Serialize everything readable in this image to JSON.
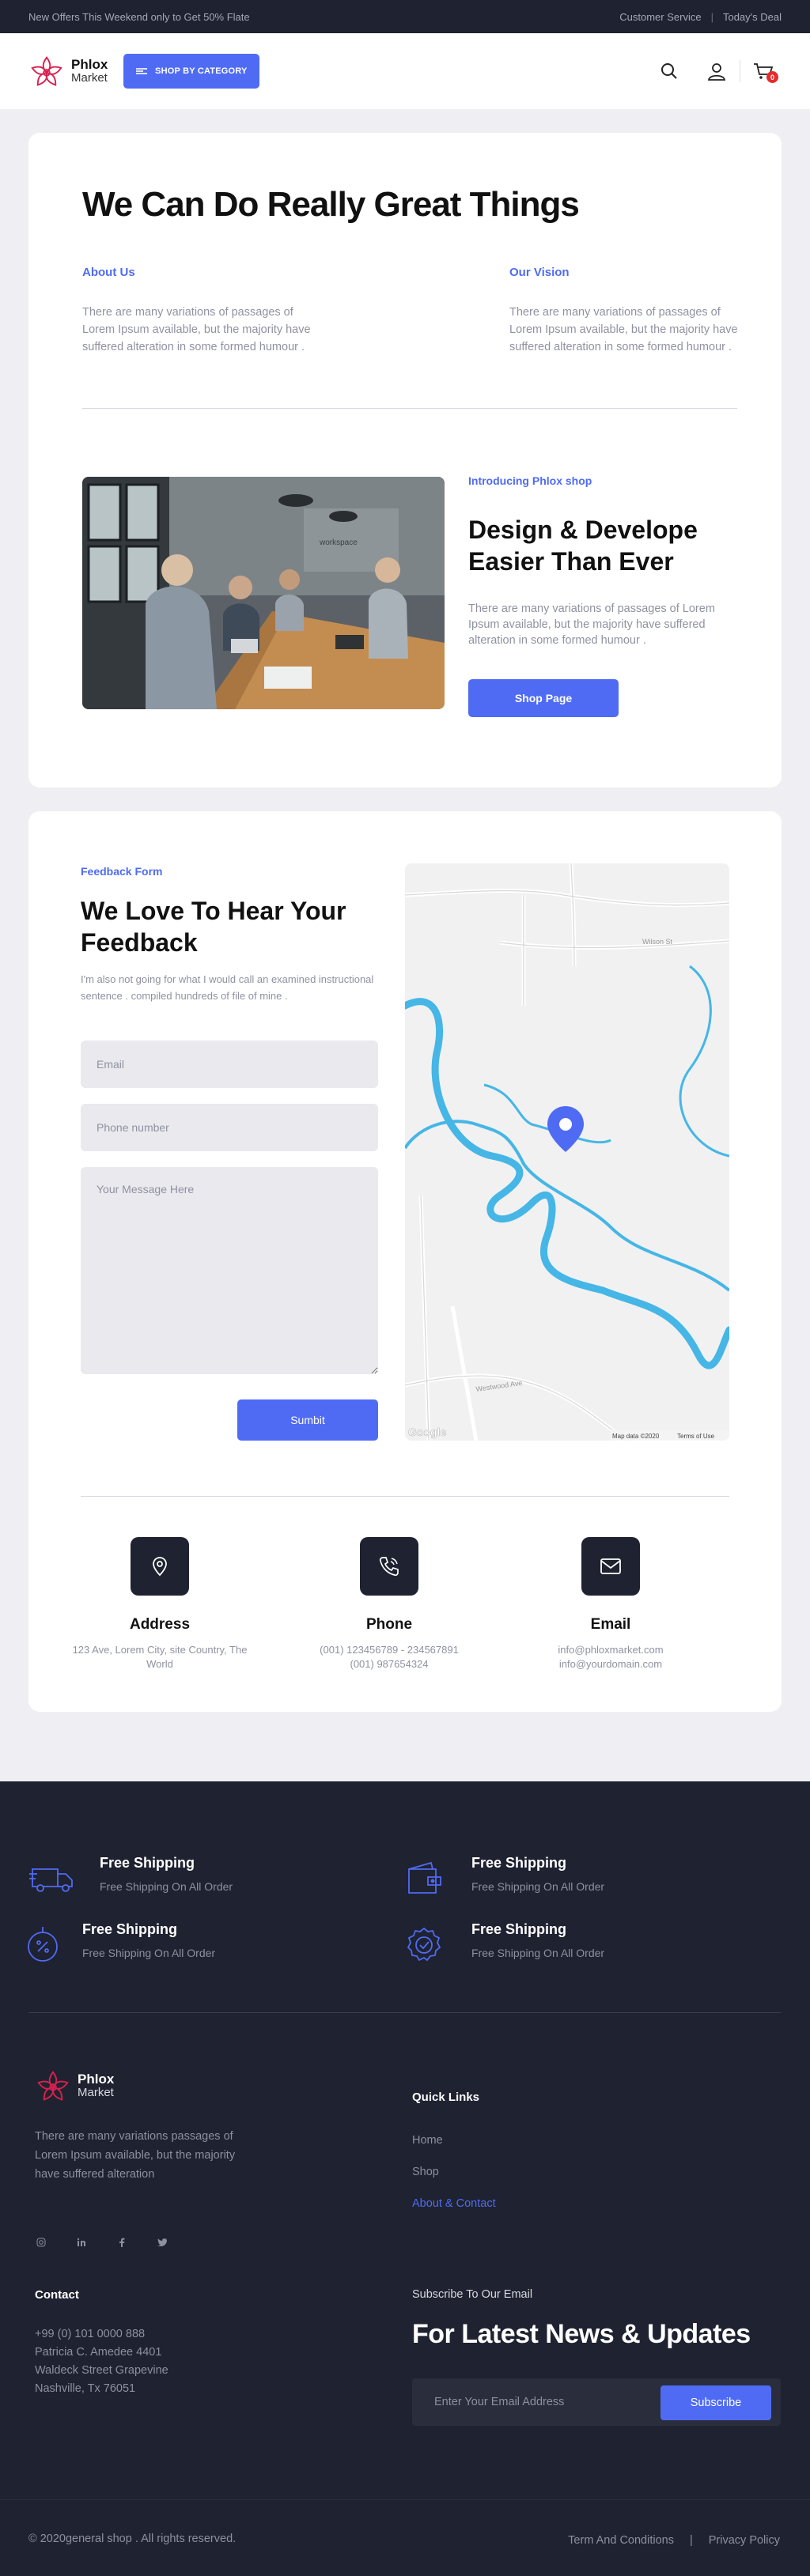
{
  "topbar": {
    "promo": "New Offers This Weekend only to Get 50% Flate",
    "customer_service": "Customer Service",
    "separator": "|",
    "todays_deal": "Today's Deal"
  },
  "brand": {
    "name": "Phlox",
    "sub": "Market",
    "accent": "#4f6bf4",
    "logo_color": "#d8214f"
  },
  "header": {
    "category_button": "SHOP BY CATEGORY",
    "cart_count": "0"
  },
  "about": {
    "title": "We Can Do Really Great Things",
    "columns": [
      {
        "heading": "About Us",
        "text": "There are many variations of passages of Lorem Ipsum available, but the majority have suffered alteration in some formed humour ."
      },
      {
        "heading": "Our Vision",
        "text": "There are many variations of passages of Lorem Ipsum available, but the majority have suffered alteration in some formed humour ."
      }
    ],
    "intro_tag": "Introducing Phlox shop",
    "intro_title": "Design & Develope Easier Than Ever",
    "intro_text": "There are many variations of passages of Lorem Ipsum available, but the majority have suffered alteration in some formed humour .",
    "shop_button": "Shop Page"
  },
  "feedback": {
    "tag": "Feedback Form",
    "title": "We Love To Hear Your Feedback",
    "text": "I'm also not going for what I would call an examined instructional sentence . compiled hundreds of file of mine .",
    "email_placeholder": "Email",
    "phone_placeholder": "Phone number",
    "message_placeholder": "Your Message Here",
    "submit": "Sumbit"
  },
  "map": {
    "street_1": "Wilson St",
    "street_2": "Westwood Ave",
    "attribution": "Map data ©2020",
    "terms": "Terms of Use",
    "provider": "Google"
  },
  "contact_info": [
    {
      "title": "Address",
      "lines": [
        "123 Ave, Lorem City, site Country, The",
        "World"
      ]
    },
    {
      "title": "Phone",
      "lines": [
        "(001) 123456789 - 234567891",
        "(001) 987654324"
      ]
    },
    {
      "title": "Email",
      "lines": [
        "info@phloxmarket.com",
        "info@yourdomain.com"
      ]
    }
  ],
  "features": [
    {
      "title": "Free Shipping",
      "sub": "Free Shipping On All Order",
      "icon": "truck-icon"
    },
    {
      "title": "Free Shipping",
      "sub": "Free Shipping On All Order",
      "icon": "wallet-icon"
    },
    {
      "title": "Free Shipping",
      "sub": "Free Shipping On All Order",
      "icon": "discount-icon"
    },
    {
      "title": "Free Shipping",
      "sub": "Free Shipping On All Order",
      "icon": "badge-icon"
    }
  ],
  "footer": {
    "description": "There are many variations passages of Lorem Ipsum available, but the majority have suffered alteration",
    "quick_links_heading": "Quick Links",
    "quick_links": [
      "Home",
      "Shop",
      "About & Contact"
    ],
    "contact_heading": "Contact",
    "contact_lines": [
      "+99 (0) 101 0000 888",
      "Patricia C. Amedee 4401",
      "Waldeck Street Grapevine",
      "Nashville, Tx 76051"
    ],
    "subscribe_heading": "Subscribe To Our Email",
    "subscribe_title": "For Latest News & Updates",
    "subscribe_placeholder": "Enter Your Email Address",
    "subscribe_button": "Subscribe",
    "copyright": "© 2020general shop . All rights reserved.",
    "terms": "Term And Conditions",
    "legal_separator": "|",
    "privacy": "Privacy Policy"
  }
}
